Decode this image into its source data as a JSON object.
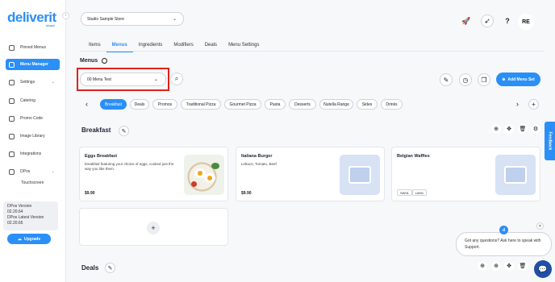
{
  "brand": {
    "logo": "deliverit",
    "logo_sub": "cloud"
  },
  "sidebar": {
    "items": [
      {
        "label": "Pinned Menus",
        "icon": "pin-icon"
      },
      {
        "label": "Menu Manager",
        "icon": "menu-icon"
      },
      {
        "label": "Settings",
        "icon": "gear-icon"
      },
      {
        "label": "Catering",
        "icon": "calendar-icon"
      },
      {
        "label": "Promo Code",
        "icon": "tag-icon"
      },
      {
        "label": "Image Library",
        "icon": "image-icon"
      },
      {
        "label": "Integrations",
        "icon": "link-icon"
      },
      {
        "label": "DPos",
        "icon": "pos-icon"
      }
    ],
    "sub_item": "Touchscreen",
    "version": {
      "dpos_version_label": "DPos Version",
      "dpos_version": "02.20.64",
      "dpos_latest_label": "DPos Latest Version",
      "dpos_latest": "02.20.65"
    },
    "upgrade_label": "Upgrade"
  },
  "header": {
    "store": "Studio Sample Store",
    "avatar": "RE"
  },
  "tabs": [
    "Items",
    "Menus",
    "Ingredients",
    "Modifiers",
    "Deals",
    "Menu Settings"
  ],
  "menus": {
    "title": "Menus",
    "selected_menu": "00 Menu Test",
    "add_menu_set": "Add Menu Set"
  },
  "categories": [
    "Breakfast",
    "Deals",
    "Promos",
    "Traditional Pizza",
    "Gourmet Pizza",
    "Pasta",
    "Desserts",
    "Nutella Range",
    "Sides",
    "Drinks"
  ],
  "sections": {
    "breakfast": "Breakfast",
    "deals": "Deals"
  },
  "cards": [
    {
      "title": "Eggs Breakfast",
      "desc": "breakfast featuring your choice of eggs, cooked just the way you like them.",
      "price": "$9.90"
    },
    {
      "title": "Italiana Burger",
      "desc": "Lettuce, Tomato, Beef",
      "price": "$9.90"
    },
    {
      "title": "Belgian Waffles",
      "tags": [
        "SW01",
        "LW01"
      ]
    }
  ],
  "feedback": "Feedback",
  "chat": {
    "message": "Got any questions? Ask here to speak with Support.",
    "avatar": "d"
  },
  "colors": {
    "accent": "#2a8ff7",
    "highlight": "#e0201b"
  }
}
